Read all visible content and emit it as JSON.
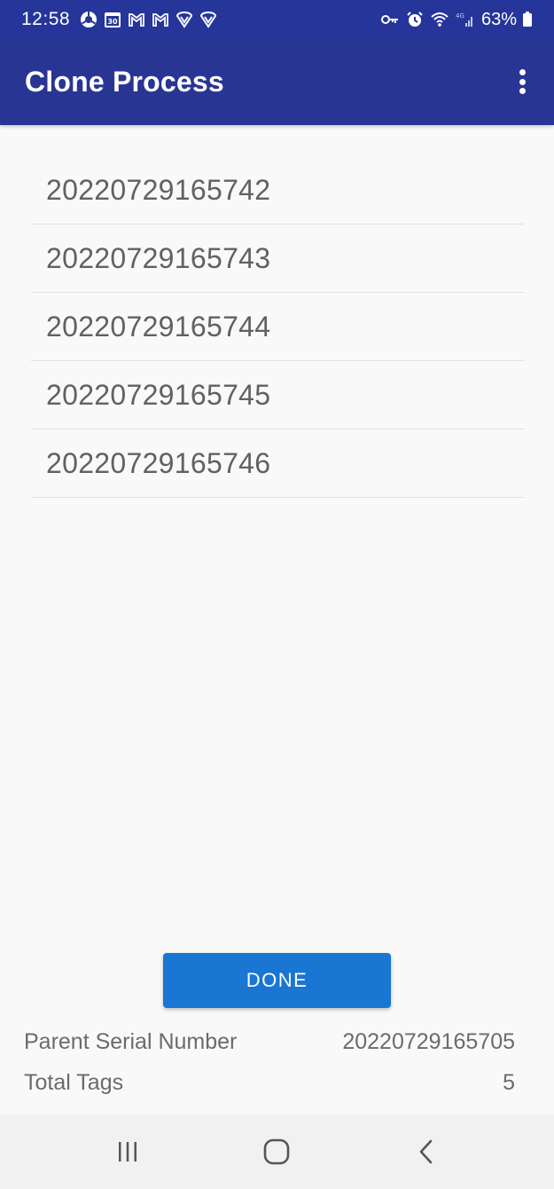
{
  "status_bar": {
    "time": "12:58",
    "battery_percent": "63%",
    "left_icons": [
      "chrome-icon",
      "calendar-icon",
      "gmail-icon",
      "gmail-icon",
      "shield-icon",
      "shield-icon"
    ],
    "right_icons": [
      "vpn-key-icon",
      "alarm-icon",
      "wifi-icon",
      "signal-icon",
      "battery-icon"
    ]
  },
  "app_bar": {
    "title": "Clone Process",
    "overflow_icon": "more-vert-icon"
  },
  "list": {
    "items": [
      "20220729165742",
      "20220729165743",
      "20220729165744",
      "20220729165745",
      "20220729165746"
    ]
  },
  "actions": {
    "done_label": "DONE"
  },
  "info": {
    "parent_label": "Parent Serial Number",
    "parent_value": "20220729165705",
    "total_label": "Total Tags",
    "total_value": "5"
  },
  "nav_bar": {
    "icons": [
      "recents-icon",
      "home-icon",
      "back-icon"
    ]
  },
  "colors": {
    "status_bar": "#26359a",
    "app_bar": "#283593",
    "accent": "#1976d2",
    "background": "#f9f9f9"
  }
}
